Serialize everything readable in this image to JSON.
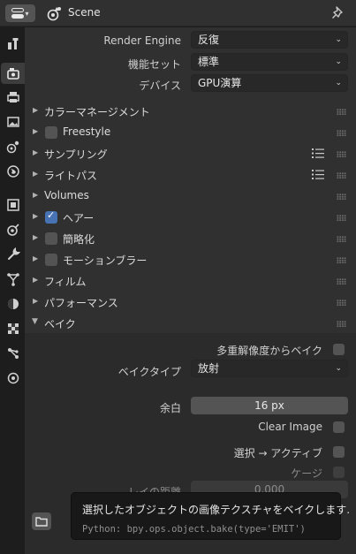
{
  "header": {
    "context_label": "Scene",
    "editor_type_icon": "properties-editor-icon",
    "pin_icon": "pin-icon"
  },
  "sidebar": {
    "tabs": [
      {
        "name": "tool-tab",
        "icon": "tool-icon"
      },
      {
        "name": "render-tab",
        "icon": "render-camera-icon",
        "active": true
      },
      {
        "name": "output-tab",
        "icon": "printer-icon"
      },
      {
        "name": "view-layer-tab",
        "icon": "image-icon"
      },
      {
        "name": "scene-tab",
        "icon": "scene-icon"
      },
      {
        "name": "world-tab",
        "icon": "world-icon"
      },
      {
        "name": "object-tab",
        "icon": "object-icon"
      },
      {
        "name": "physics-tab",
        "icon": "physics-icon"
      },
      {
        "name": "modifier-tab",
        "icon": "wrench-icon"
      },
      {
        "name": "particles-tab",
        "icon": "particles-icon"
      },
      {
        "name": "shading-tab",
        "icon": "shading-icon"
      },
      {
        "name": "texture-tab",
        "icon": "checker-icon"
      },
      {
        "name": "constraints-tab",
        "icon": "constraints-icon"
      },
      {
        "name": "data-tab",
        "icon": "data-icon"
      }
    ]
  },
  "render": {
    "engine_label": "Render Engine",
    "engine_value": "反復",
    "feature_label": "機能セット",
    "feature_value": "標準",
    "device_label": "デバイス",
    "device_value": "GPU演算"
  },
  "panels": {
    "color_management": "カラーマネージメント",
    "freestyle": "Freestyle",
    "sampling": "サンプリング",
    "light_paths": "ライトパス",
    "volumes": "Volumes",
    "hair": "ヘアー",
    "simplify": "簡略化",
    "motion_blur": "モーションブラー",
    "film": "フィルム",
    "performance": "パフォーマンス",
    "bake": "ベイク"
  },
  "bake": {
    "multires_label": "多重解像度からベイク",
    "bake_type_label": "ベイクタイプ",
    "bake_type_value": "放射",
    "margin_label": "余白",
    "margin_value": "16 px",
    "clear_image_label": "Clear Image",
    "selected_to_active_label": "選択 → アクティブ",
    "cage_label": "ケージ",
    "ray_distance_label": "レイの距離",
    "ray_distance_value": "0.000"
  },
  "tooltip": {
    "description": "選択したオブジェクトの画像テクスチャをベイクします.",
    "python": "Python: bpy.ops.object.bake(type='EMIT')"
  },
  "colors": {
    "accent": "#4772b3",
    "panel_bg": "#303030",
    "field_bg": "#545454"
  }
}
